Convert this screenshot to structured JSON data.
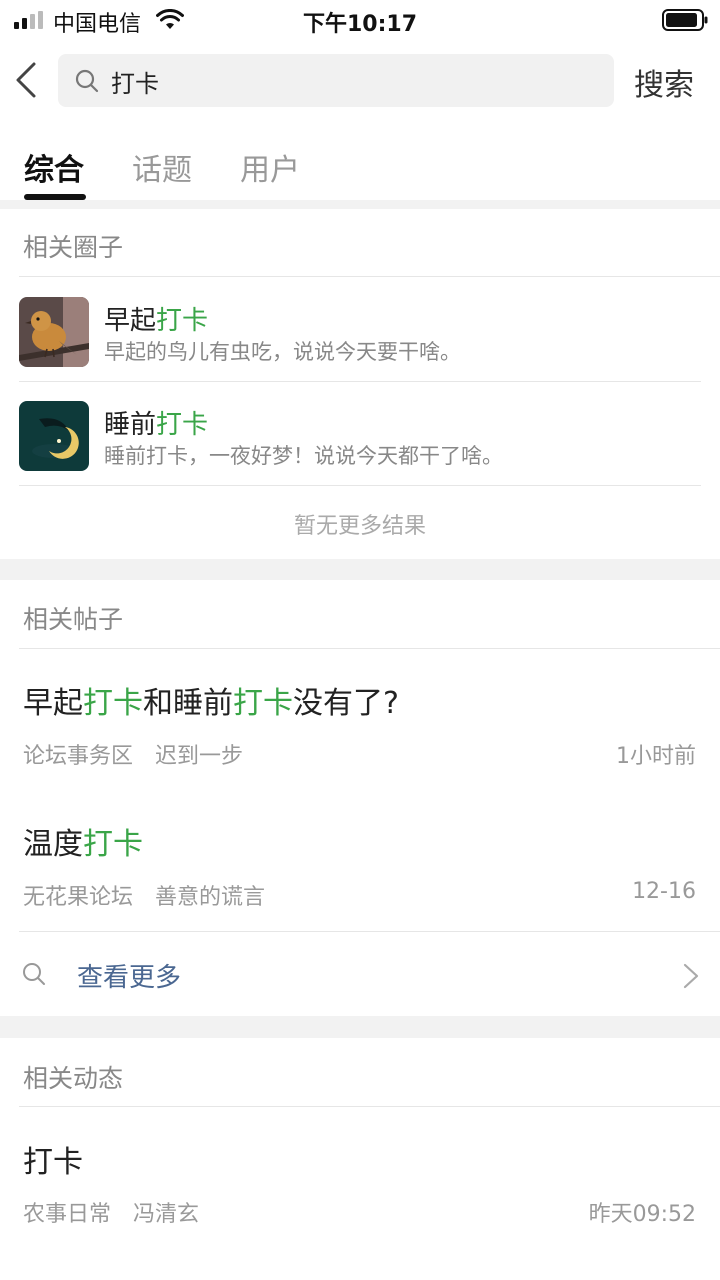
{
  "status_bar": {
    "carrier": "中国电信",
    "time": "下午10:17"
  },
  "search": {
    "query": "打卡",
    "button_label": "搜索"
  },
  "tabs": [
    {
      "label": "综合",
      "active": true
    },
    {
      "label": "话题",
      "active": false
    },
    {
      "label": "用户",
      "active": false
    }
  ],
  "circles": {
    "title": "相关圈子",
    "items": [
      {
        "title_prefix": "早起",
        "title_highlight": "打卡",
        "description": "早起的鸟儿有虫吃，说说今天要干啥。",
        "avatar": "bird-avatar"
      },
      {
        "title_prefix": "睡前",
        "title_highlight": "打卡",
        "description": "睡前打卡，一夜好梦！说说今天都干了啥。",
        "avatar": "moon-avatar"
      }
    ],
    "no_more": "暂无更多结果"
  },
  "posts": {
    "title": "相关帖子",
    "items": [
      {
        "parts": [
          "早起",
          "打卡",
          "和睡前",
          "打卡",
          "没有了?"
        ],
        "forum": "论坛事务区",
        "author": "迟到一步",
        "time": "1小时前"
      },
      {
        "parts": [
          "温度",
          "打卡"
        ],
        "forum": "无花果论坛",
        "author": "善意的谎言",
        "time": "12-16"
      }
    ],
    "view_more": "查看更多"
  },
  "moments": {
    "title": "相关动态",
    "items": [
      {
        "title_highlight": "打卡",
        "forum": "农事日常",
        "author": "冯清玄",
        "time": "昨天09:52"
      }
    ]
  },
  "colors": {
    "highlight": "#3aa548",
    "link": "#4a6791",
    "background_gap": "#f2f2f2"
  }
}
